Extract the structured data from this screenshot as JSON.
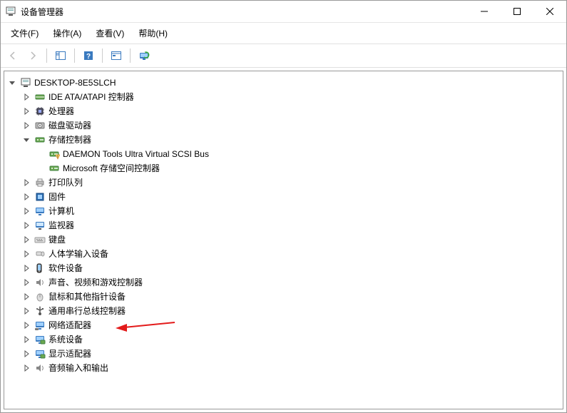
{
  "window": {
    "title": "设备管理器"
  },
  "menu": {
    "file": "文件(F)",
    "action": "操作(A)",
    "view": "查看(V)",
    "help": "帮助(H)"
  },
  "toolbar": {},
  "tree": {
    "root": {
      "label": "DESKTOP-8E5SLCH",
      "expanded": true
    },
    "categories": [
      {
        "id": "ide",
        "label": "IDE ATA/ATAPI 控制器",
        "icon": "ide",
        "expanded": false
      },
      {
        "id": "cpu",
        "label": "处理器",
        "icon": "cpu",
        "expanded": false
      },
      {
        "id": "disk",
        "label": "磁盘驱动器",
        "icon": "disk",
        "expanded": false
      },
      {
        "id": "storage",
        "label": "存储控制器",
        "icon": "storage",
        "expanded": true,
        "children": [
          {
            "id": "daemon",
            "label": "DAEMON Tools Ultra Virtual SCSI Bus",
            "icon": "storage-warn"
          },
          {
            "id": "msstor",
            "label": "Microsoft 存储空间控制器",
            "icon": "storage"
          }
        ]
      },
      {
        "id": "print",
        "label": "打印队列",
        "icon": "printer",
        "expanded": false
      },
      {
        "id": "firmware",
        "label": "固件",
        "icon": "firmware",
        "expanded": false
      },
      {
        "id": "computer",
        "label": "计算机",
        "icon": "computer",
        "expanded": false
      },
      {
        "id": "monitor",
        "label": "监视器",
        "icon": "monitor",
        "expanded": false
      },
      {
        "id": "keyboard",
        "label": "键盘",
        "icon": "keyboard",
        "expanded": false
      },
      {
        "id": "hid",
        "label": "人体学输入设备",
        "icon": "hid",
        "expanded": false
      },
      {
        "id": "software",
        "label": "软件设备",
        "icon": "software",
        "expanded": false
      },
      {
        "id": "sound",
        "label": "声音、视频和游戏控制器",
        "icon": "sound",
        "expanded": false
      },
      {
        "id": "mouse",
        "label": "鼠标和其他指针设备",
        "icon": "mouse",
        "expanded": false
      },
      {
        "id": "usb",
        "label": "通用串行总线控制器",
        "icon": "usb",
        "expanded": false
      },
      {
        "id": "network",
        "label": "网络适配器",
        "icon": "network",
        "expanded": false,
        "highlight_arrow": true
      },
      {
        "id": "system",
        "label": "系统设备",
        "icon": "system",
        "expanded": false
      },
      {
        "id": "gpu",
        "label": "显示适配器",
        "icon": "gpu",
        "expanded": false
      },
      {
        "id": "audio",
        "label": "音频输入和输出",
        "icon": "audio",
        "expanded": false
      }
    ]
  }
}
